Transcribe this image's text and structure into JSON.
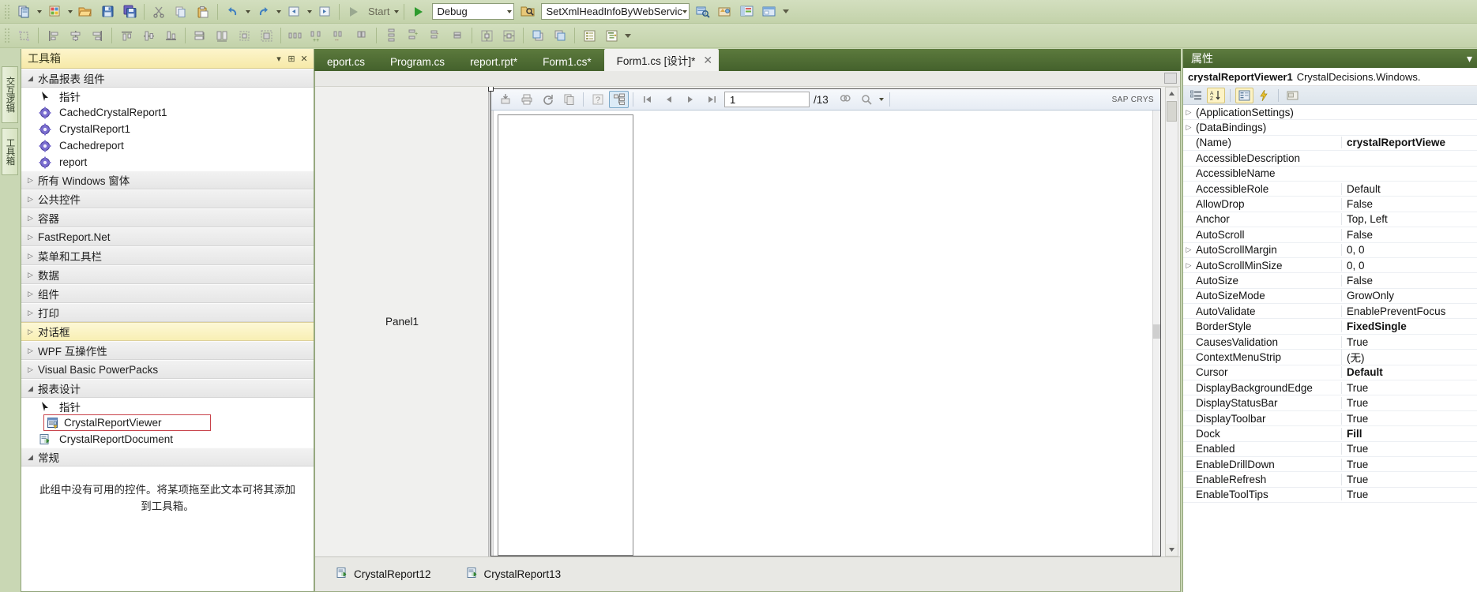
{
  "toolbars": {
    "row1": {
      "start_label": "Start",
      "config_combo": "Debug",
      "project_combo": "SetXmlHeadInfoByWebServic"
    }
  },
  "leftdock": {
    "tabs": [
      "交互逻辑",
      "工具箱"
    ]
  },
  "toolbox": {
    "title": "工具箱",
    "groups": [
      {
        "label": "水晶报表 组件",
        "expanded": true,
        "highlight": false,
        "items": [
          {
            "label": "指针",
            "icon": "pointer-icon"
          },
          {
            "label": "CachedCrystalReport1",
            "icon": "gear-icon"
          },
          {
            "label": "CrystalReport1",
            "icon": "gear-icon"
          },
          {
            "label": "Cachedreport",
            "icon": "gear-icon"
          },
          {
            "label": "report",
            "icon": "gear-icon"
          }
        ]
      },
      {
        "label": "所有 Windows 窗体",
        "expanded": false,
        "highlight": false,
        "items": []
      },
      {
        "label": "公共控件",
        "expanded": false,
        "highlight": false,
        "items": []
      },
      {
        "label": "容器",
        "expanded": false,
        "highlight": false,
        "items": []
      },
      {
        "label": "FastReport.Net",
        "expanded": false,
        "highlight": false,
        "items": []
      },
      {
        "label": "菜单和工具栏",
        "expanded": false,
        "highlight": false,
        "items": []
      },
      {
        "label": "数据",
        "expanded": false,
        "highlight": false,
        "items": []
      },
      {
        "label": "组件",
        "expanded": false,
        "highlight": false,
        "items": []
      },
      {
        "label": "打印",
        "expanded": false,
        "highlight": false,
        "items": []
      },
      {
        "label": "对话框",
        "expanded": false,
        "highlight": true,
        "items": []
      },
      {
        "label": "WPF 互操作性",
        "expanded": false,
        "highlight": false,
        "items": []
      },
      {
        "label": "Visual Basic PowerPacks",
        "expanded": false,
        "highlight": false,
        "items": []
      },
      {
        "label": "报表设计",
        "expanded": true,
        "highlight": false,
        "items": [
          {
            "label": "指针",
            "icon": "pointer-icon"
          },
          {
            "label": "CrystalReportViewer",
            "icon": "report-viewer-icon",
            "boxed": true
          },
          {
            "label": "CrystalReportDocument",
            "icon": "report-document-icon"
          }
        ]
      },
      {
        "label": "常规",
        "expanded": true,
        "highlight": false,
        "items": []
      }
    ],
    "empty_note": "此组中没有可用的控件。将某项拖至此文本可将其添加到工具箱。"
  },
  "editor_tabs": [
    {
      "label": "eport.cs",
      "active": false
    },
    {
      "label": "Program.cs",
      "active": false
    },
    {
      "label": "report.rpt*",
      "active": false
    },
    {
      "label": "Form1.cs*",
      "active": false
    },
    {
      "label": "Form1.cs [设计]*",
      "active": true,
      "close": "✕"
    }
  ],
  "designer": {
    "panel_label": "Panel1",
    "viewer": {
      "page_value": "1",
      "page_total": "/13",
      "branding": "SAP CRYS",
      "buttons": [
        "export-icon",
        "print-icon",
        "refresh-icon",
        "copy-icon",
        "toggle-help-icon",
        "group-tree-icon",
        "first-page-icon",
        "previous-page-icon",
        "next-page-icon",
        "last-page-icon",
        "find-icon",
        "zoom-icon"
      ]
    },
    "tray": [
      {
        "label": "CrystalReport12",
        "icon": "report-document-icon"
      },
      {
        "label": "CrystalReport13",
        "icon": "report-document-icon"
      }
    ]
  },
  "properties": {
    "title": "属性",
    "object_name": "crystalReportViewer1",
    "object_type": "CrystalDecisions.Windows.",
    "toolbar_buttons": [
      "categorized-icon",
      "alphabetical-icon",
      "properties-icon",
      "events-icon",
      "property-pages-icon"
    ],
    "rows": [
      {
        "name": "(ApplicationSettings)",
        "value": "",
        "expandable": true,
        "bold": false
      },
      {
        "name": "(DataBindings)",
        "value": "",
        "expandable": true,
        "bold": false
      },
      {
        "name": "(Name)",
        "value": "crystalReportViewe",
        "expandable": false,
        "bold": true
      },
      {
        "name": "AccessibleDescription",
        "value": "",
        "expandable": false,
        "bold": false
      },
      {
        "name": "AccessibleName",
        "value": "",
        "expandable": false,
        "bold": false
      },
      {
        "name": "AccessibleRole",
        "value": "Default",
        "expandable": false,
        "bold": false
      },
      {
        "name": "AllowDrop",
        "value": "False",
        "expandable": false,
        "bold": false
      },
      {
        "name": "Anchor",
        "value": "Top, Left",
        "expandable": false,
        "bold": false
      },
      {
        "name": "AutoScroll",
        "value": "False",
        "expandable": false,
        "bold": false
      },
      {
        "name": "AutoScrollMargin",
        "value": "0, 0",
        "expandable": true,
        "bold": false
      },
      {
        "name": "AutoScrollMinSize",
        "value": "0, 0",
        "expandable": true,
        "bold": false
      },
      {
        "name": "AutoSize",
        "value": "False",
        "expandable": false,
        "bold": false
      },
      {
        "name": "AutoSizeMode",
        "value": "GrowOnly",
        "expandable": false,
        "bold": false
      },
      {
        "name": "AutoValidate",
        "value": "EnablePreventFocus",
        "expandable": false,
        "bold": false
      },
      {
        "name": "BorderStyle",
        "value": "FixedSingle",
        "expandable": false,
        "bold": true
      },
      {
        "name": "CausesValidation",
        "value": "True",
        "expandable": false,
        "bold": false
      },
      {
        "name": "ContextMenuStrip",
        "value": "(无)",
        "expandable": false,
        "bold": false
      },
      {
        "name": "Cursor",
        "value": "Default",
        "expandable": false,
        "bold": true
      },
      {
        "name": "DisplayBackgroundEdge",
        "value": "True",
        "expandable": false,
        "bold": false
      },
      {
        "name": "DisplayStatusBar",
        "value": "True",
        "expandable": false,
        "bold": false
      },
      {
        "name": "DisplayToolbar",
        "value": "True",
        "expandable": false,
        "bold": false
      },
      {
        "name": "Dock",
        "value": "Fill",
        "expandable": false,
        "bold": true
      },
      {
        "name": "Enabled",
        "value": "True",
        "expandable": false,
        "bold": false
      },
      {
        "name": "EnableDrillDown",
        "value": "True",
        "expandable": false,
        "bold": false
      },
      {
        "name": "EnableRefresh",
        "value": "True",
        "expandable": false,
        "bold": false
      },
      {
        "name": "EnableToolTips",
        "value": "True",
        "expandable": false,
        "bold": false
      }
    ]
  },
  "colors": {
    "chrome_green": "#c9d7b4",
    "title_green": "#4f6e34",
    "highlight_yellow": "#f8efb4",
    "selection_red": "#c8424a"
  }
}
